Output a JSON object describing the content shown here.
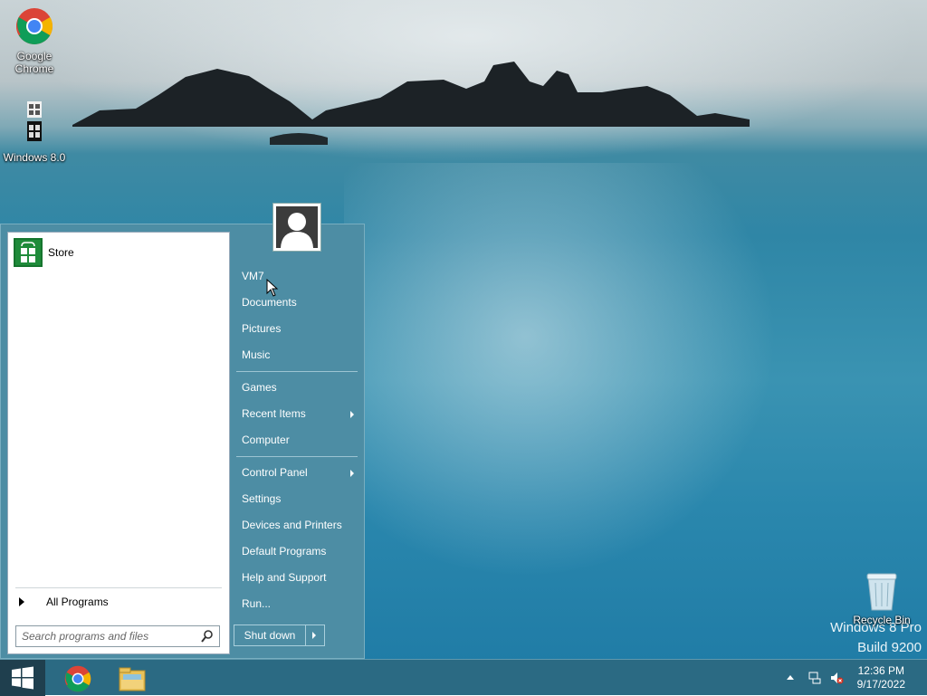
{
  "desktop": {
    "icons": [
      {
        "label": "Google\nChrome",
        "line1": "Google",
        "line2": "Chrome"
      },
      {
        "label": "Windows 8.0"
      },
      {
        "label": "Recycle Bin"
      }
    ],
    "watermark": {
      "line1": "Windows 8 Pro",
      "line2": "Build 9200"
    }
  },
  "start_menu": {
    "pinned": [
      {
        "label": "Store"
      }
    ],
    "all_programs": "All Programs",
    "search": {
      "placeholder": "Search programs and files",
      "value": ""
    },
    "right_items": {
      "user": "VM7",
      "documents": "Documents",
      "pictures": "Pictures",
      "music": "Music",
      "games": "Games",
      "recent_items": "Recent Items",
      "computer": "Computer",
      "control_panel": "Control Panel",
      "settings": "Settings",
      "devices_printers": "Devices and Printers",
      "default_programs": "Default Programs",
      "help_support": "Help and Support",
      "run": "Run..."
    },
    "shutdown_label": "Shut down"
  },
  "taskbar": {
    "apps": [
      "Google Chrome",
      "File Explorer"
    ],
    "clock": {
      "time": "12:36 PM",
      "date": "9/17/2022"
    }
  }
}
